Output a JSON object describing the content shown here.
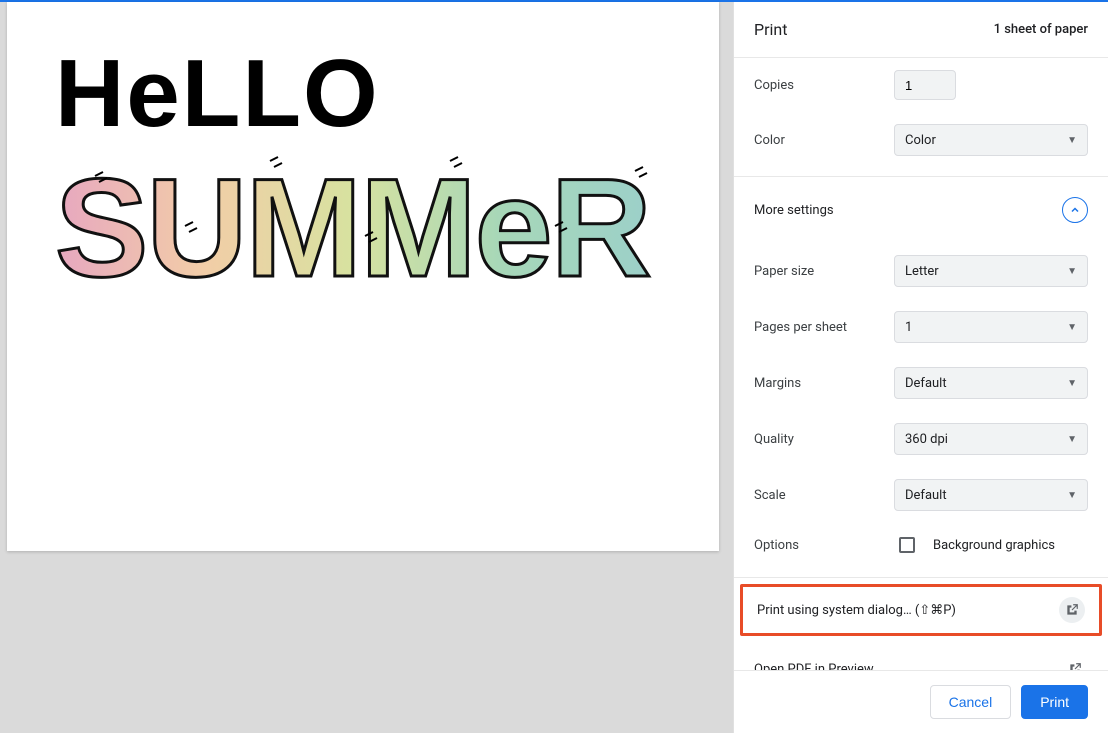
{
  "header": {
    "title": "Print",
    "sheet_info": "1 sheet of paper"
  },
  "settings": {
    "copies_label": "Copies",
    "copies_value": "1",
    "color_label": "Color",
    "color_value": "Color",
    "more_settings_label": "More settings",
    "paper_size_label": "Paper size",
    "paper_size_value": "Letter",
    "pages_per_sheet_label": "Pages per sheet",
    "pages_per_sheet_value": "1",
    "margins_label": "Margins",
    "margins_value": "Default",
    "quality_label": "Quality",
    "quality_value": "360 dpi",
    "scale_label": "Scale",
    "scale_value": "Default",
    "options_label": "Options",
    "background_graphics_label": "Background graphics"
  },
  "system": {
    "system_dialog_label": "Print using system dialog… (⇧⌘P)",
    "open_pdf_label": "Open PDF in Preview"
  },
  "footer": {
    "cancel_label": "Cancel",
    "print_label": "Print"
  },
  "preview": {
    "line1": "HeLLO",
    "line2": "SUMMER"
  }
}
